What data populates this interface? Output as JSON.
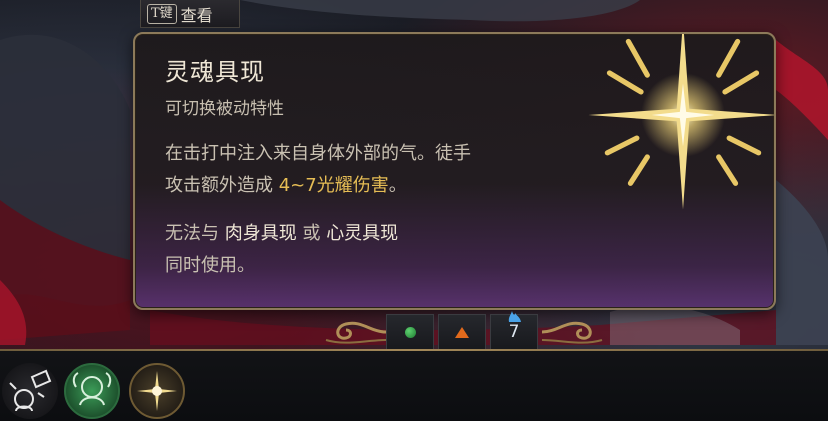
{
  "hint": {
    "key": "T键",
    "label": "查看"
  },
  "tooltip": {
    "title": "灵魂具现",
    "subtitle": "可切换被动特性",
    "description_line1": "在击打中注入来自身体外部的气。徒手",
    "description_line2_prefix": "攻击额外造成 ",
    "description_damage": "4~7光耀伤害",
    "description_line2_suffix": "。",
    "note_prefix": "无法与 ",
    "note_item1": "肉身具现",
    "note_mid": " 或 ",
    "note_item2": "心灵具现",
    "note_line2": "同时使用。",
    "icon": "radiant-star-icon",
    "colors": {
      "highlight": "#e6bd55",
      "border": "#8c7a5a"
    }
  },
  "resources": {
    "action_icon": "green-dot-icon",
    "bonus_action_icon": "orange-triangle-icon",
    "ki_icon": "blue-flame-icon",
    "ki_points": "7"
  },
  "hotbar": {
    "slots": [
      {
        "icon": "unarmed-strike-icon"
      },
      {
        "icon": "body-manifestation-icon"
      },
      {
        "icon": "soul-manifestation-icon"
      }
    ]
  }
}
